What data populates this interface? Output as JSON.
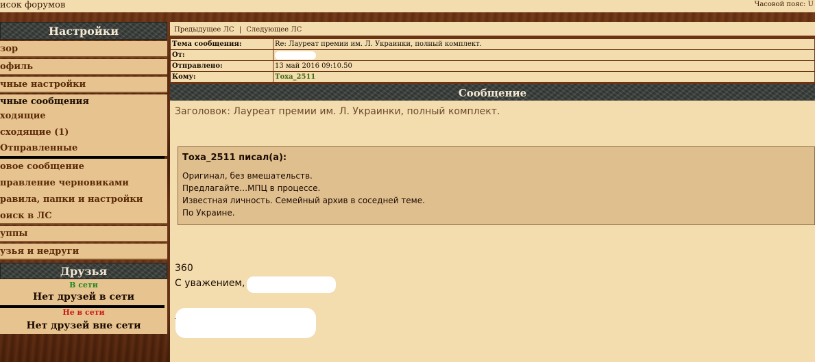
{
  "topbar": {
    "forums_link": "исок форумов",
    "timezone": "Часовой пояс: U"
  },
  "sidebar": {
    "settings_title": "Настройки",
    "items": [
      {
        "label": "зор"
      },
      {
        "label": "офиль"
      },
      {
        "label": "чные настройки"
      }
    ],
    "pm_section": "чные сообщения",
    "pm_items": [
      {
        "label": "ходящие"
      },
      {
        "label": "сходящие (1)"
      },
      {
        "label": "Отправленные"
      }
    ],
    "tools": [
      {
        "label": "овое сообщение"
      },
      {
        "label": "правление черновиками"
      },
      {
        "label": "равила, папки и настройки"
      },
      {
        "label": "оиск в ЛС"
      }
    ],
    "groups": [
      {
        "label": "уппы"
      },
      {
        "label": "узья и недруги"
      }
    ],
    "friends_title": "Друзья",
    "online_label": "В сети",
    "online_none": "Нет друзей в сети",
    "offline_label": "Не в сети",
    "offline_none": "Нет друзей вне сети"
  },
  "main": {
    "prev_pm": "Предыдущее ЛС",
    "separator": "|",
    "next_pm": "Следующее ЛС",
    "meta": {
      "subject_key": "Тема сообщения:",
      "subject_val": "Re: Лауреат премии им. Л. Украинки, полный комплект.",
      "from_key": "От:",
      "sent_key": "Отправлено:",
      "sent_val": "13 май 2016 09:10.50",
      "to_key": "Кому:",
      "to_val": "Тоха_2511"
    },
    "message_title": "Сообщение",
    "subject_line": "Заголовок: Лауреат премии им. Л. Украинки, полный комплект.",
    "quote": {
      "author": "Тоха_2511 писал(а):",
      "lines": [
        "Оригинал, без вмешательств.",
        "Предлагайте…МПЦ в процессе.",
        "Известная личность. Семейный архив в соседней теме.",
        "По Украине."
      ]
    },
    "signature_number": "360",
    "signature_regards": "С уважением,"
  }
}
